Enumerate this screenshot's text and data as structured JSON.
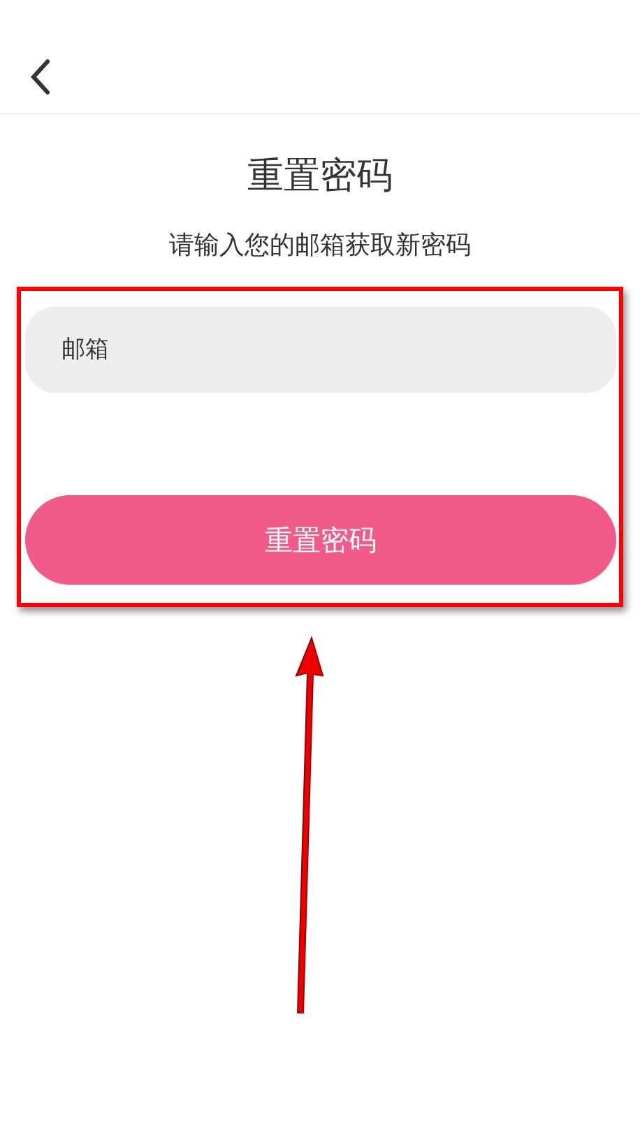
{
  "title": "重置密码",
  "subtitle": "请输入您的邮箱获取新密码",
  "email_field": {
    "placeholder": "邮箱"
  },
  "submit_button": {
    "label": "重置密码"
  }
}
